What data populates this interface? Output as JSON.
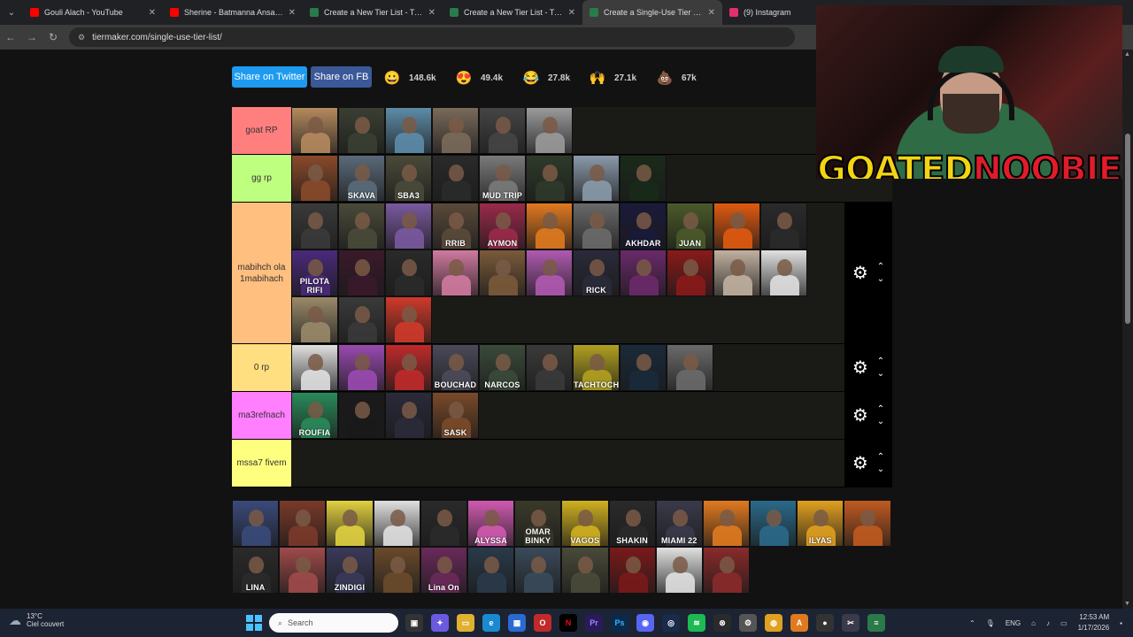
{
  "browser": {
    "tabs": [
      {
        "label": "Gouli Alach - YouTube",
        "color": "#ff0000"
      },
      {
        "label": "Sherine - Batmanna Ansak | شيرين",
        "color": "#ff0000"
      },
      {
        "label": "Create a New Tier List - TierMaker",
        "color": "#2b7a4b"
      },
      {
        "label": "Create a New Tier List - TierMaker",
        "color": "#2b7a4b"
      },
      {
        "label": "Create a Single-Use Tier List (P",
        "color": "#2b7a4b"
      },
      {
        "label": "(9) Instagram",
        "color": "#e1306c"
      }
    ],
    "url": "tiermaker.com/single-use-tier-list/"
  },
  "share": {
    "twitter": "Share on Twitter",
    "fb": "Share on FB"
  },
  "reactions": [
    {
      "icon": "grinning-face-icon",
      "count": "148.6k",
      "glyph": "😀",
      "color": "#f7c23b"
    },
    {
      "icon": "heart-eyes-icon",
      "count": "49.4k",
      "glyph": "😍",
      "color": "#f7c23b"
    },
    {
      "icon": "laughing-face-icon",
      "count": "27.8k",
      "glyph": "😂",
      "color": "#f7c23b"
    },
    {
      "icon": "praying-hands-icon",
      "count": "27.1k",
      "glyph": "🙌",
      "color": "#f7c23b"
    },
    {
      "icon": "poop-icon",
      "count": "67k",
      "glyph": "💩",
      "color": "#8d5a3b"
    }
  ],
  "tiers": [
    {
      "label": "goat RP",
      "color": "#ff7f7f",
      "items": [
        {
          "c": "#b58a5e"
        },
        {
          "c": "#3a3f32"
        },
        {
          "c": "#5d8ca8"
        },
        {
          "c": "#7a6a5a"
        },
        {
          "c": "#454545"
        },
        {
          "c": "#9a9a9a"
        }
      ]
    },
    {
      "label": "gg rp",
      "color": "#bfff7f",
      "items": [
        {
          "c": "#8a4a2a"
        },
        {
          "c": "#5a6a7a",
          "t": "SKAVA"
        },
        {
          "c": "#4a4a3a",
          "t": "SBA3"
        },
        {
          "c": "#2a2a2a"
        },
        {
          "c": "#7a7a7a",
          "t": "MUD TRIP"
        },
        {
          "c": "#2f3a2a"
        },
        {
          "c": "#8a9aaa"
        },
        {
          "c": "#1a2a1a"
        }
      ]
    },
    {
      "label": "mabihch ola 1mabihach",
      "color": "#ffbf7f",
      "items": [
        {
          "c": "#3a3a3a"
        },
        {
          "c": "#4a4a3a"
        },
        {
          "c": "#7a5aa0"
        },
        {
          "c": "#5a4a3a",
          "t": "RRIB"
        },
        {
          "c": "#9a2a4a",
          "t": "AYMON"
        },
        {
          "c": "#e07a20"
        },
        {
          "c": "#6a6a6a"
        },
        {
          "c": "#1a1a3a",
          "t": "AKHDAR"
        },
        {
          "c": "#4a5a2a",
          "t": "JUAN"
        },
        {
          "c": "#e05a10"
        },
        {
          "c": "#2a2a2a"
        },
        {
          "c": "#4a2a7a",
          "t": "PILOTA RIFI"
        },
        {
          "c": "#3a1a2a"
        },
        {
          "c": "#2a2a2a"
        },
        {
          "c": "#d07aa0"
        },
        {
          "c": "#7a5a3a"
        },
        {
          "c": "#b05ab0"
        },
        {
          "c": "#2a2a3a",
          "t": "RICK"
        },
        {
          "c": "#6a2a6a"
        },
        {
          "c": "#8a1a1a"
        },
        {
          "c": "#c0b0a0"
        },
        {
          "c": "#e0e0e0"
        },
        {
          "c": "#9a8a6a"
        },
        {
          "c": "#3a3a3a"
        },
        {
          "c": "#d03a2a"
        }
      ]
    },
    {
      "label": "0 rp",
      "color": "#ffdf7f",
      "items": [
        {
          "c": "#e0e0e0"
        },
        {
          "c": "#9a4ab0"
        },
        {
          "c": "#c02a2a"
        },
        {
          "c": "#4a4a5a",
          "t": "BOUCHAD"
        },
        {
          "c": "#3a4a3a",
          "t": "NARCOS"
        },
        {
          "c": "#3a3a3a"
        },
        {
          "c": "#b0a020",
          "t": "TACHTOCH"
        },
        {
          "c": "#1a2a3a"
        },
        {
          "c": "#6a6a6a"
        }
      ]
    },
    {
      "label": "ma3refnach",
      "color": "#ff7fff",
      "items": [
        {
          "c": "#2a8a5a",
          "t": "ROUFIA"
        },
        {
          "c": "#1a1a1a"
        },
        {
          "c": "#2a2a3a"
        },
        {
          "c": "#7a4a2a",
          "t": "SASK"
        }
      ]
    },
    {
      "label": "mssa7 fivem",
      "color": "#ffff7f",
      "items": []
    }
  ],
  "pool": [
    {
      "c": "#3a4a7a"
    },
    {
      "c": "#7a3a2a"
    },
    {
      "c": "#e0d040"
    },
    {
      "c": "#e0e0e0"
    },
    {
      "c": "#2a2a2a"
    },
    {
      "c": "#d05ab0",
      "t": "ALYSSA"
    },
    {
      "c": "#3a3a2a",
      "t": "OMAR BINKY"
    },
    {
      "c": "#d0b020",
      "t": "VAGOS"
    },
    {
      "c": "#2a2a2a",
      "t": "SHAKIN"
    },
    {
      "c": "#3a3a4a",
      "t": "MIAMI 22"
    },
    {
      "c": "#e07a20"
    },
    {
      "c": "#2a6a8a"
    },
    {
      "c": "#e0a020",
      "t": "ILYAS"
    },
    {
      "c": "#c05a20"
    },
    {
      "c": "#2a2a2a",
      "t": "LINA"
    },
    {
      "c": "#a04a4a"
    },
    {
      "c": "#3a3a5a",
      "t": "ZINDIGI"
    },
    {
      "c": "#6a4a2a"
    },
    {
      "c": "#6a2a5a",
      "t": "Lina On"
    },
    {
      "c": "#2a3a4a"
    },
    {
      "c": "#3a4a5a"
    },
    {
      "c": "#4a4a3a"
    },
    {
      "c": "#7a1a1a"
    },
    {
      "c": "#e0e0e0"
    },
    {
      "c": "#8a2a2a"
    }
  ],
  "cam": {
    "logo_a": "GOATED",
    "logo_b": "NOOBIE"
  },
  "taskbar": {
    "temp": "13°C",
    "weather": "Ciel couvert",
    "search": "Search",
    "lang": "ENG",
    "time": "12:53 AM",
    "date": "1/17/2026"
  }
}
